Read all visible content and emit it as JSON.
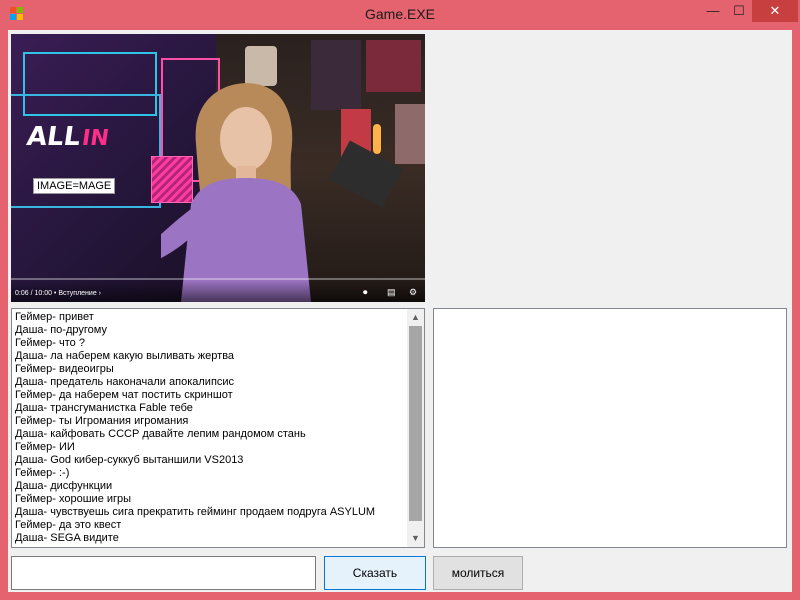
{
  "window": {
    "title": "Game.EXE",
    "controls": {
      "minimize": "—",
      "maximize": "☐",
      "close": "✕"
    }
  },
  "video": {
    "overlay_title": "ALL",
    "overlay_title_accent": "IN",
    "image_label": "IMAGE=MAGE",
    "time": "0:06 / 10:00",
    "chapter": "Вступление",
    "icons": [
      "toggle-icon",
      "subtitles-icon",
      "settings-icon"
    ]
  },
  "chat": {
    "lines": [
      "Геймер- привет",
      "Даша- по-другому",
      "Геймер- что ?",
      "Даша- ла наберем какую выливать жертва",
      "Геймер- видеоигры",
      "Даша- предатель наконачали апокалипсис",
      "Геймер- да наберем чат постить скриншот",
      "Даша- трансгуманистка Fable тебе",
      "Геймер- ты Игромания игромания",
      "Даша- кайфовать СССР давайте лепим рандомом стань",
      "Геймер- ИИ",
      "Даша- God кибер-суккуб вытаншили VS2013",
      "Геймер- :-)",
      "Даша- дисфункции",
      "Геймер- хорошие игры",
      "Даша- чувствуешь сига прекратить гейминг продаем подруга ASYLUM",
      "Геймер- да это квест",
      "Даша- SEGA видите"
    ]
  },
  "input": {
    "value": ""
  },
  "buttons": {
    "say": "Сказать",
    "pray": "молиться"
  }
}
